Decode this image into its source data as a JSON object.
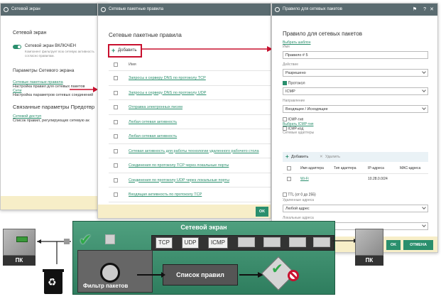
{
  "win1": {
    "title": "Сетевой экран",
    "section_title": "Сетевой экран",
    "toggle_label": "Сетевой экран ВКЛЮЧЕН",
    "toggle_desc": "Компонент фильтрует всю сетевую активность согласно правилам.",
    "params_title": "Параметры Сетевого экрана",
    "link_packet_rules": "Сетевые пакетные правила",
    "desc_packet_rules": "Настройка правил для сетевых пакетов",
    "link_networks": "Сети",
    "desc_networks": "Настройка параметров сетевых соединений",
    "related_title": "Связанные параметры Предотвр",
    "link_related": "Сетевой доступ",
    "desc_related": "Список правил, регулирующих сетевую ак"
  },
  "win2": {
    "title": "Сетевые пакетные правила",
    "heading": "Сетевые пакетные правила",
    "add_label": "Добавить",
    "col_name": "Имя",
    "rows": [
      "Запросы к серверу DNS по протоколу TCP",
      "Запросы к серверу DNS по протоколу UDP",
      "Отправка электронных писем",
      "Любая сетевая активность",
      "Любая сетевая активность",
      "Сетевая активность для работы технологии удаленного рабочего стола",
      "Соединения по протоколу TCP через локальные порты",
      "Соединения по протоколу UDP через локальные порты",
      "Входящая активность по протоколу TCP",
      ""
    ],
    "ok_label": "OK"
  },
  "win3": {
    "title": "Правило для сетевых пакетов",
    "heading": "Правило для сетевых пакетов",
    "template_link": "Выбрать шаблон",
    "name_label": "Имя",
    "name_value": "Правило # 5",
    "action_label": "Действие",
    "action_value": "Разрешено",
    "protocol_label": "Протокол",
    "protocol_value": "ICMP",
    "direction_label": "Направление",
    "direction_value": "Входящее / Исходящее",
    "icmp_type": "ICMP-тип",
    "icmp_type_link": "Выбрать ICMP-тип",
    "icmp_code": "ICMP-код",
    "adapters_label": "Сетевые адаптеры",
    "add_label": "Добавить",
    "delete_label": "Удалить",
    "col_name": "Имя адаптера",
    "col_type": "Тип адаптера",
    "col_ip": "IP-адреса",
    "col_mac": "MAC-адреса",
    "adapter_name": "Wi-Fi",
    "adapter_ip": "10.28.0.0/24",
    "ttl_label": "TTL (от 0 до 255)",
    "remote_label": "Удаленные адреса",
    "remote_value": "Любой адрес",
    "local_label": "Локальные адреса",
    "ok_label": "OK",
    "cancel_label": "ОТМЕНА"
  },
  "diagram": {
    "title": "Сетевой экран",
    "pc_left": "ПК",
    "pc_right": "ПК",
    "tcp": "TCP",
    "udp": "UDP",
    "icmp": "ICMP",
    "rules_list": "Список правил",
    "filter": "Фильтр пакетов"
  },
  "colors": {
    "accent": "#2a8f6d",
    "diagram_green": "#3d8f6e",
    "highlight_red": "#c8102e"
  }
}
